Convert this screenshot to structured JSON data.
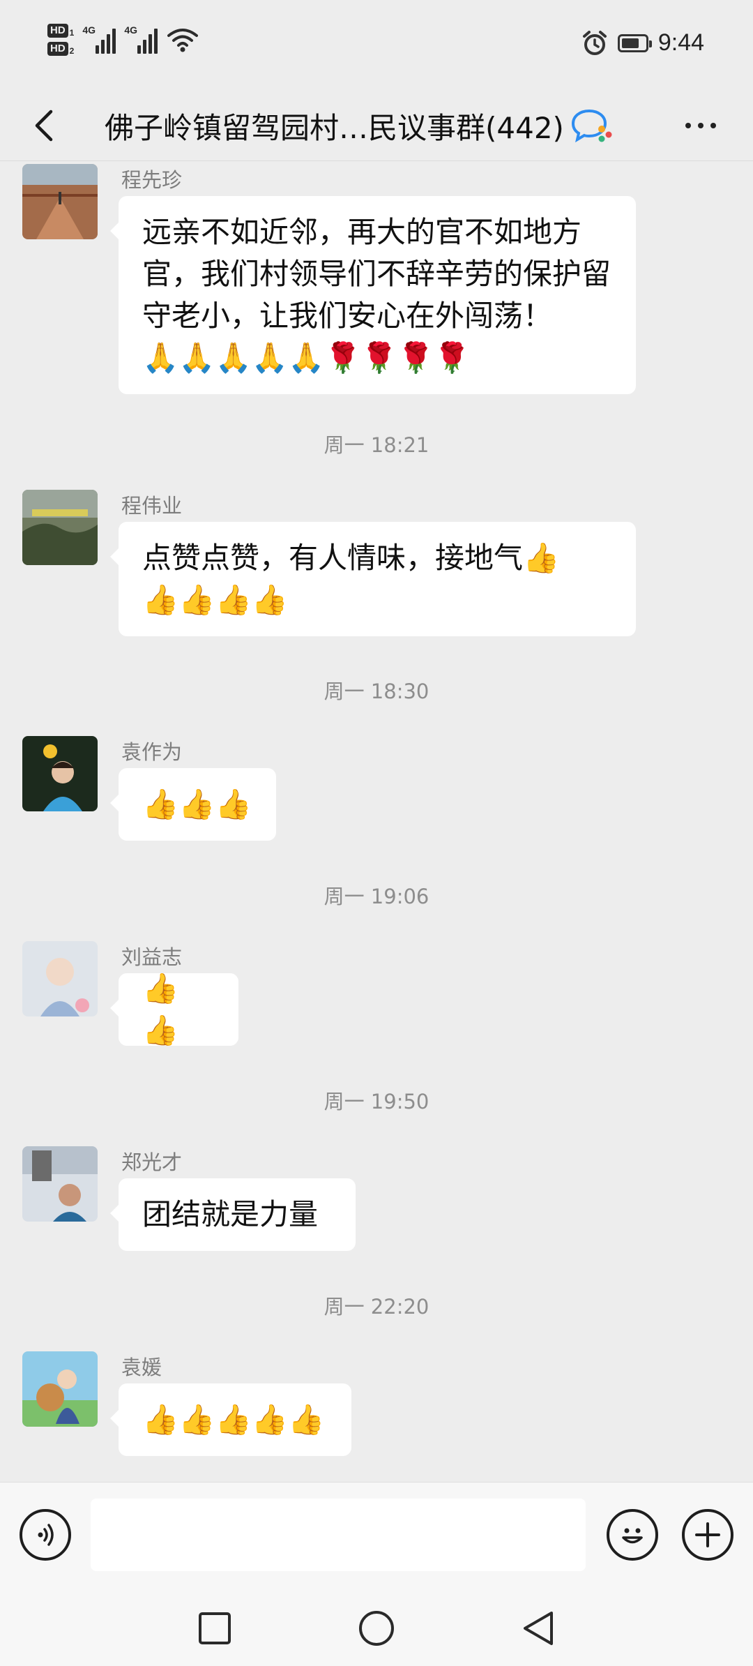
{
  "status_bar": {
    "hd1": "HD",
    "hd1_sub": "1",
    "hd2": "HD",
    "hd2_sub": "2",
    "network1": "4G",
    "network2": "4G",
    "time": "9:44",
    "battery_level": 0.75
  },
  "header": {
    "title": "佛子岭镇留驾园村…民议事群(442)"
  },
  "messages": [
    {
      "sender": "程先珍",
      "text": "远亲不如近邻，再大的官不如地方官，我们村领导们不辞辛劳的保护留守老小，让我们安心在外闯荡！",
      "emoji": "🙏🙏🙏🙏🙏🌹🌹🌹🌹"
    },
    {
      "time": "周一 18:21"
    },
    {
      "sender": "程伟业",
      "text": "点赞点赞，有人情味，接地气",
      "emoji_first": "👍",
      "emoji": "👍👍👍👍"
    },
    {
      "time": "周一 18:30"
    },
    {
      "sender": "袁作为",
      "emoji": "👍👍👍"
    },
    {
      "time": "周一 19:06"
    },
    {
      "sender": "刘益志",
      "emoji": "👍👍"
    },
    {
      "time": "周一 19:50"
    },
    {
      "sender": "郑光才",
      "text": "团结就是力量"
    },
    {
      "time": "周一 22:20"
    },
    {
      "sender": "袁媛",
      "emoji": "👍👍👍👍👍"
    }
  ],
  "input": {
    "value": "",
    "placeholder": ""
  },
  "icons": {
    "back": "back-chevron-icon",
    "group_chat": "group-chat-icon",
    "more": "more-dots-icon",
    "voice": "voice-icon",
    "sticker": "emoji-smile-icon",
    "plus": "plus-icon",
    "recents": "recents-square-icon",
    "home": "home-circle-icon",
    "back_nav": "back-triangle-icon"
  },
  "colors": {
    "background": "#ededed",
    "bubble": "#ffffff",
    "sender_gray": "#7d7d7d",
    "time_gray": "#8d8d8d",
    "chat_icon_blue": "#2d8cf0"
  }
}
